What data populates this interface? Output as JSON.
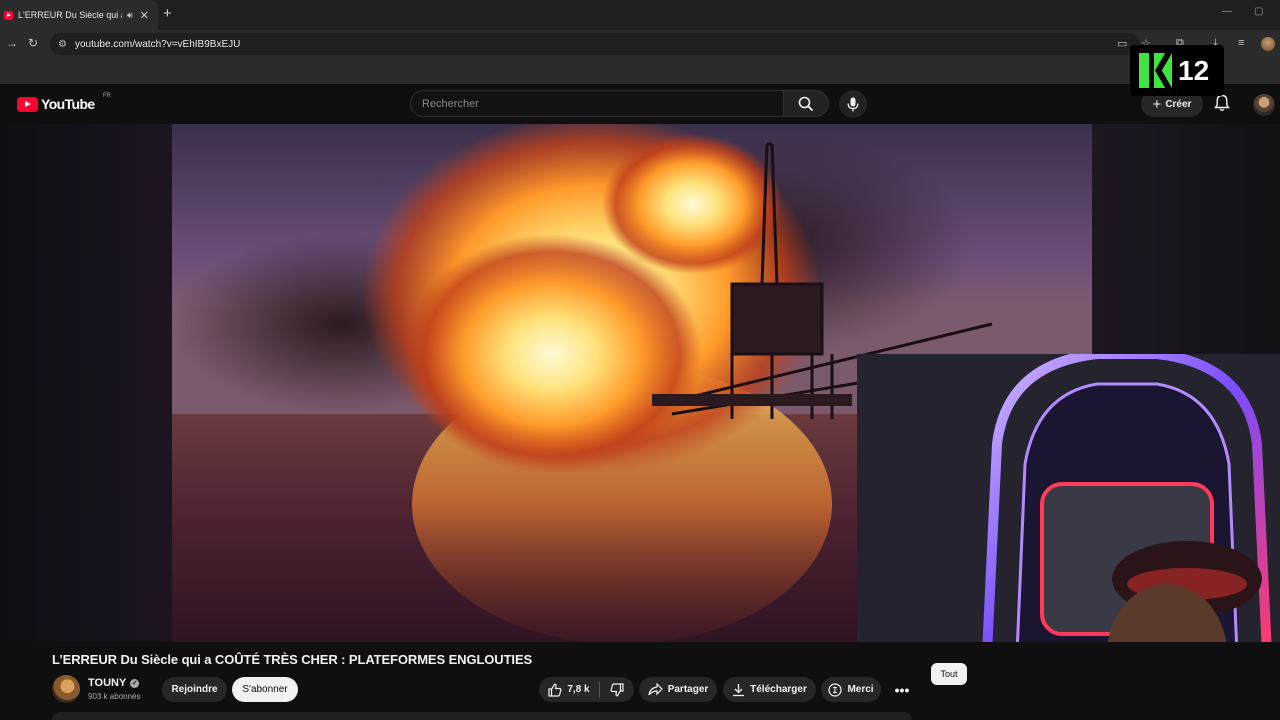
{
  "browser": {
    "tab_title": "L'ERREUR Du Siècle qui a CO",
    "tab_audio_icon": "speaker-icon",
    "tab_close": "✕",
    "new_tab": "+",
    "url": "youtube.com/watch?v=vEhIB9BxEJU"
  },
  "youtube": {
    "logo_text": "YouTube",
    "country_code": "FR",
    "search_placeholder": "Rechercher",
    "create_label": "Créer"
  },
  "overlay": {
    "rating_number": "12"
  },
  "video": {
    "title": "L’ERREUR Du Siècle qui a COÛTÉ TRÈS CHER : PLATEFORMES ENGLOUTIES",
    "channel_name": "TOUNY",
    "subscribers": "903 k abonnés",
    "join_label": "Rejoindre",
    "subscribe_label": "S'abonner",
    "like_count": "7,8 k",
    "share_label": "Partager",
    "download_label": "Télécharger",
    "thanks_label": "Merci",
    "more_label": "•••"
  },
  "chips": {
    "all_label": "Tout"
  },
  "colors": {
    "brand_red": "#ff0033",
    "k12_green": "#3ee53e",
    "background": "#0f0f0f"
  }
}
